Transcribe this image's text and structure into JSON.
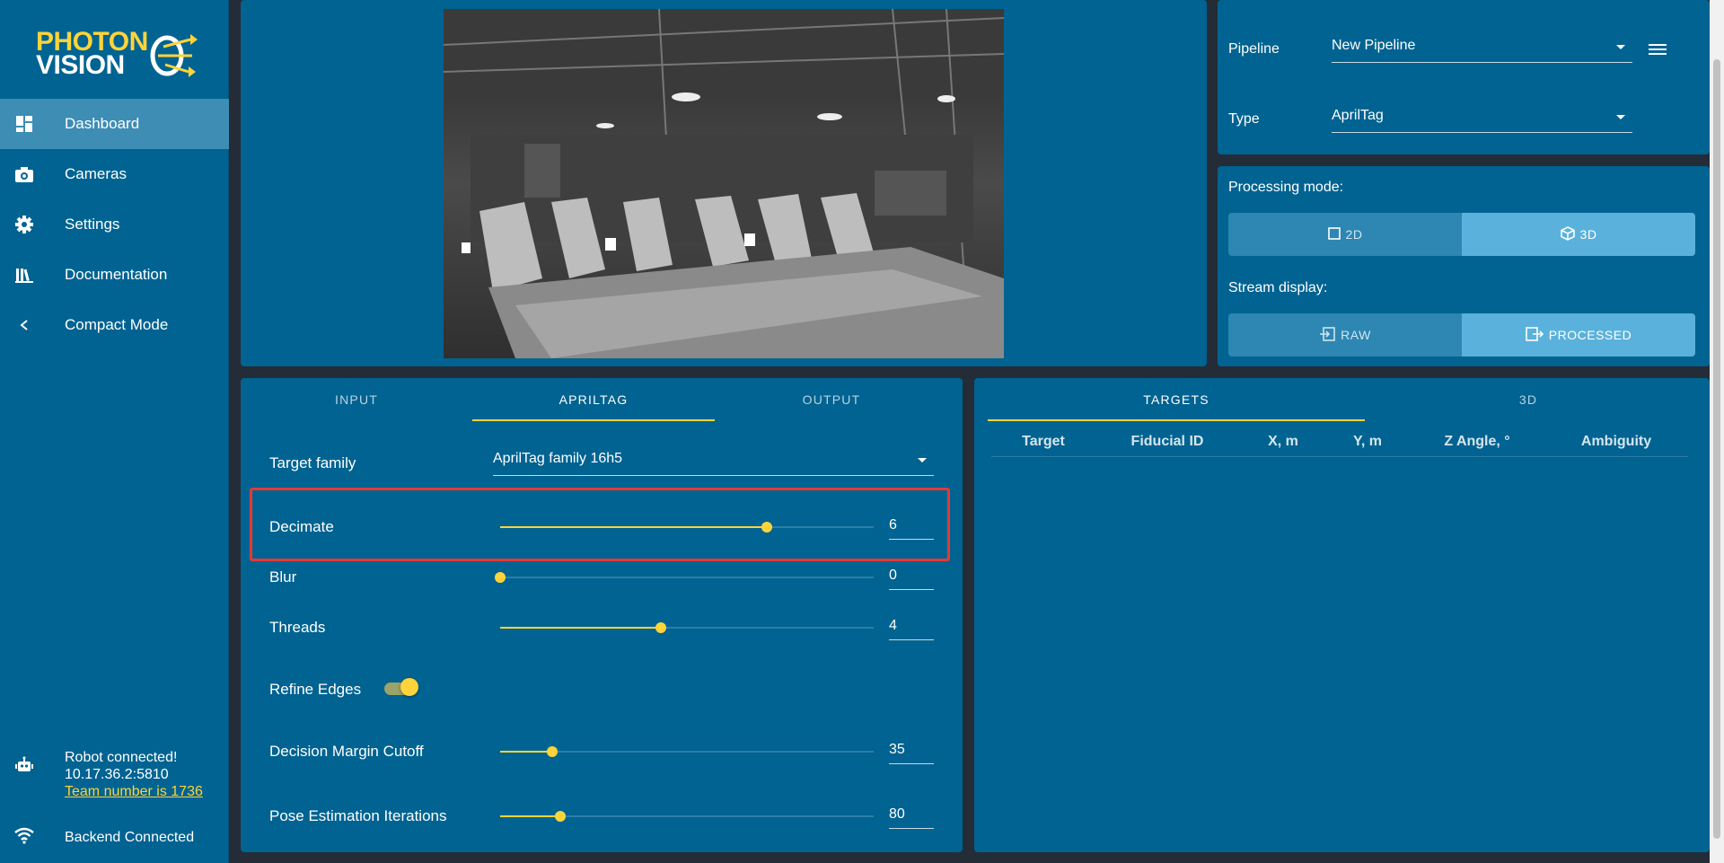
{
  "app": {
    "logo_line1": "PHOTON",
    "logo_line2": "VISION",
    "accent_color": "#ffd43a",
    "primary_color": "#006391"
  },
  "sidebar": {
    "items": [
      {
        "label": "Dashboard",
        "icon": "dashboard-icon",
        "active": true
      },
      {
        "label": "Cameras",
        "icon": "camera-icon"
      },
      {
        "label": "Settings",
        "icon": "gear-icon"
      },
      {
        "label": "Documentation",
        "icon": "books-icon"
      },
      {
        "label": "Compact Mode",
        "icon": "chevron-left-icon"
      }
    ],
    "robot_status": "Robot connected!",
    "robot_address": "10.17.36.2:5810",
    "team_link": "Team number is 1736",
    "backend_status": "Backend Connected"
  },
  "pipeline": {
    "pipeline_label": "Pipeline",
    "pipeline_value": "New Pipeline",
    "type_label": "Type",
    "type_value": "AprilTag"
  },
  "modes": {
    "processing_label": "Processing mode:",
    "processing_options": [
      "2D",
      "3D"
    ],
    "processing_selected": "3D",
    "stream_label": "Stream display:",
    "stream_options": [
      "RAW",
      "PROCESSED"
    ],
    "stream_selected": "PROCESSED"
  },
  "settings_tabs": [
    "INPUT",
    "APRILTAG",
    "OUTPUT"
  ],
  "settings_active_tab": "APRILTAG",
  "apriltag": {
    "family_label": "Target family",
    "family_value": "AprilTag family 16h5",
    "decimate": {
      "label": "Decimate",
      "value": "6",
      "fraction": 0.715
    },
    "blur": {
      "label": "Blur",
      "value": "0",
      "fraction": 0.0
    },
    "threads": {
      "label": "Threads",
      "value": "4",
      "fraction": 0.43
    },
    "refine_edges": {
      "label": "Refine Edges",
      "on": true
    },
    "decision_margin": {
      "label": "Decision Margin Cutoff",
      "value": "35",
      "fraction": 0.14
    },
    "pose_iterations": {
      "label": "Pose Estimation Iterations",
      "value": "80",
      "fraction": 0.16
    }
  },
  "results_tabs": [
    "TARGETS",
    "3D"
  ],
  "results_active_tab": "TARGETS",
  "targets_columns": [
    "Target",
    "Fiducial ID",
    "X, m",
    "Y, m",
    "Z Angle, °",
    "Ambiguity"
  ]
}
